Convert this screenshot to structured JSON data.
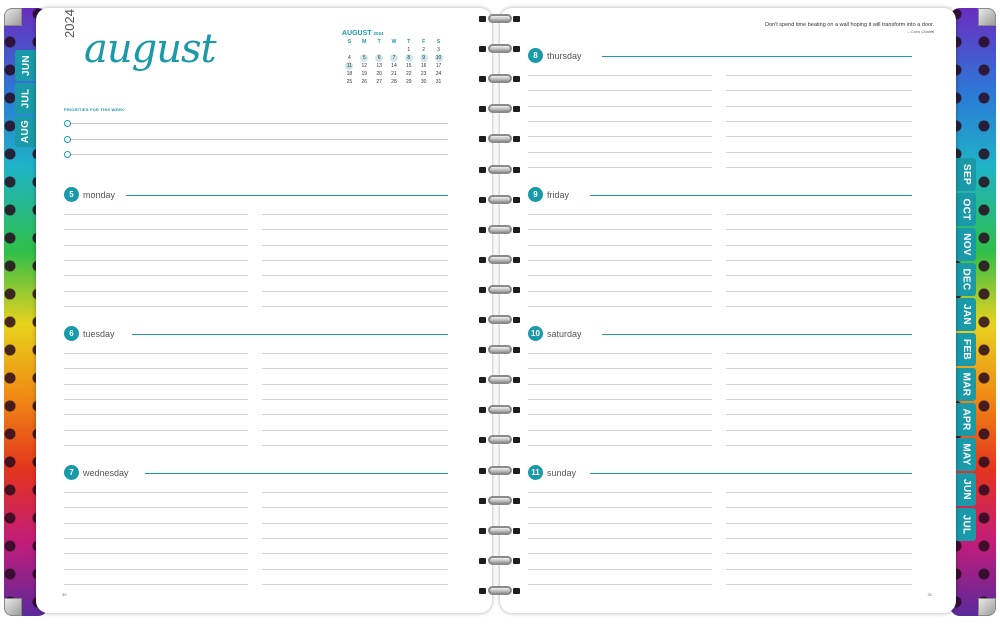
{
  "left_page": {
    "year": "2024",
    "month": "august",
    "mini_calendar": {
      "title": "AUGUST",
      "year": "2024",
      "weekdays": [
        "S",
        "M",
        "T",
        "W",
        "T",
        "F",
        "S"
      ],
      "weeks": [
        [
          "",
          "",
          "",
          "",
          "1",
          "2",
          "3"
        ],
        [
          "4",
          "5",
          "6",
          "7",
          "8",
          "9",
          "10"
        ],
        [
          "11",
          "12",
          "13",
          "14",
          "15",
          "16",
          "17"
        ],
        [
          "18",
          "19",
          "20",
          "21",
          "22",
          "23",
          "24"
        ],
        [
          "25",
          "26",
          "27",
          "28",
          "29",
          "30",
          "31"
        ]
      ],
      "highlighted": [
        "5",
        "6",
        "7",
        "8",
        "9",
        "10",
        "11"
      ]
    },
    "priorities_title": "PRIORITIES FOR THIS WEEK",
    "days": [
      {
        "num": "5",
        "name": "monday"
      },
      {
        "num": "6",
        "name": "tuesday"
      },
      {
        "num": "7",
        "name": "wednesday"
      }
    ],
    "page_number": "30"
  },
  "right_page": {
    "quote": "Don't spend time beating on a wall hoping it will transform into a door.",
    "quote_author": "– Coco Chanel",
    "days": [
      {
        "num": "8",
        "name": "thursday"
      },
      {
        "num": "9",
        "name": "friday"
      },
      {
        "num": "10",
        "name": "saturday"
      },
      {
        "num": "11",
        "name": "sunday"
      }
    ],
    "page_number": "31"
  },
  "tabs_left": [
    "JUN",
    "JUL",
    "AUG"
  ],
  "tabs_right": [
    "SEP",
    "OCT",
    "NOV",
    "DEC",
    "JAN",
    "FEB",
    "MAR",
    "APR",
    "MAY",
    "JUN",
    "JUL"
  ],
  "colors": {
    "accent": "#1a9aa8",
    "tab": "#1a9aa8",
    "rule": "#d3d3d3"
  }
}
